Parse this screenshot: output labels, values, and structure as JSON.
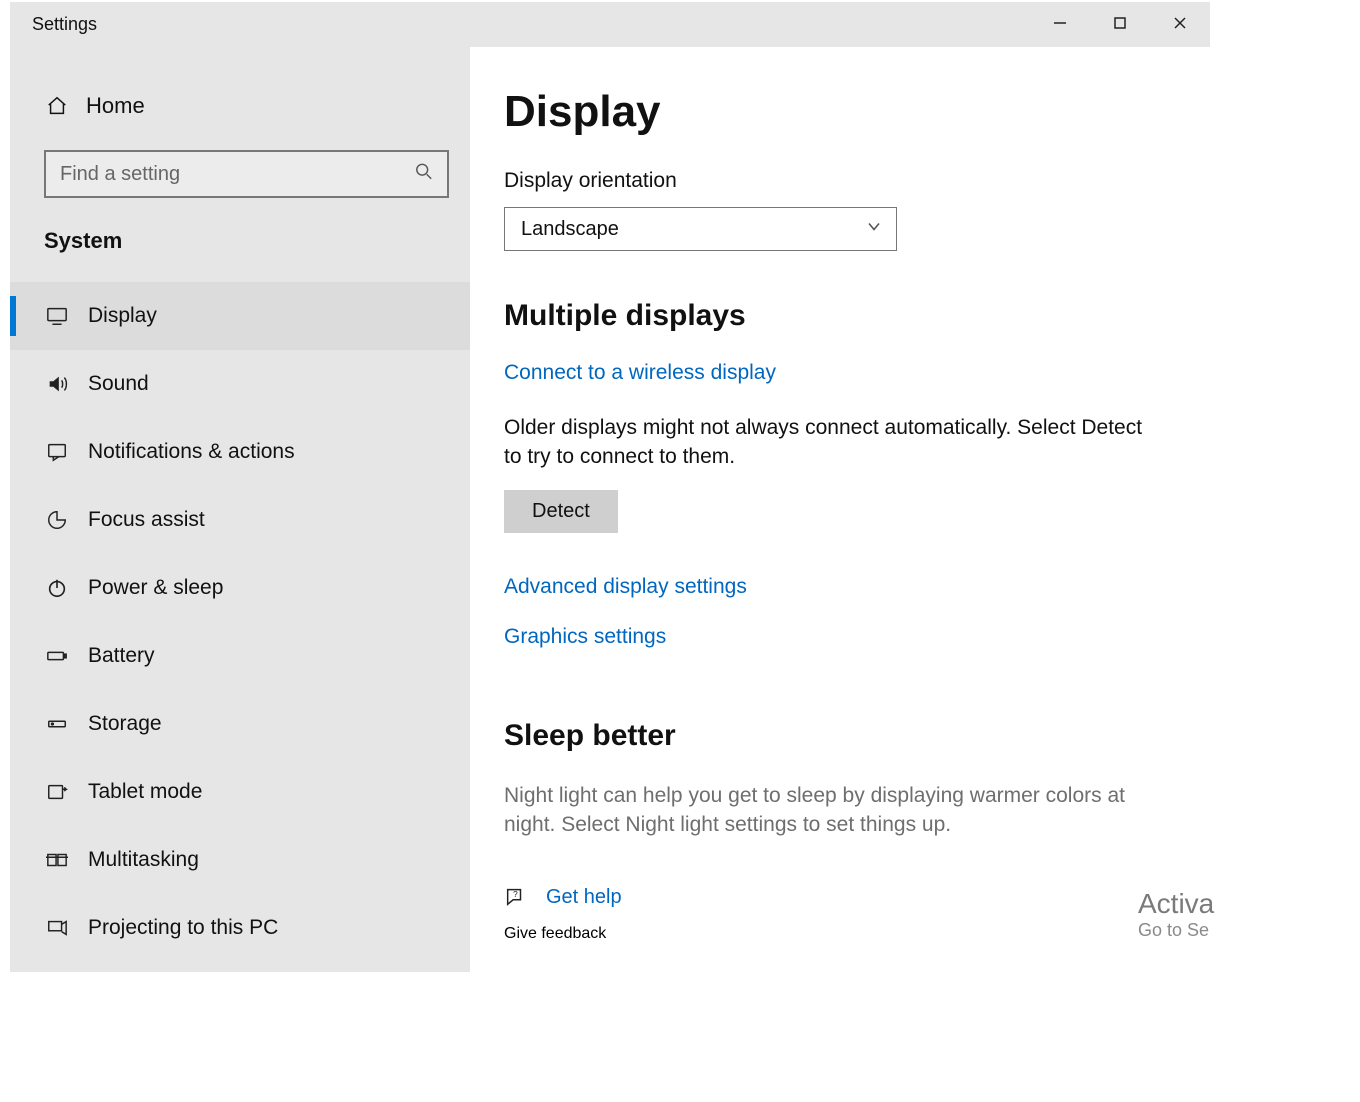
{
  "window": {
    "title": "Settings"
  },
  "sidebar": {
    "home": "Home",
    "search_placeholder": "Find a setting",
    "category": "System",
    "items": [
      {
        "label": "Display"
      },
      {
        "label": "Sound"
      },
      {
        "label": "Notifications & actions"
      },
      {
        "label": "Focus assist"
      },
      {
        "label": "Power & sleep"
      },
      {
        "label": "Battery"
      },
      {
        "label": "Storage"
      },
      {
        "label": "Tablet mode"
      },
      {
        "label": "Multitasking"
      },
      {
        "label": "Projecting to this PC"
      }
    ]
  },
  "main": {
    "title": "Display",
    "orientation_label": "Display orientation",
    "orientation_value": "Landscape",
    "multi_header": "Multiple displays",
    "connect_link": "Connect to a wireless display",
    "older_text": "Older displays might not always connect automatically. Select Detect to try to connect to them.",
    "detect_btn": "Detect",
    "adv_link": "Advanced display settings",
    "gfx_link": "Graphics settings",
    "sleep_header": "Sleep better",
    "sleep_desc": "Night light can help you get to sleep by displaying warmer colors at night. Select Night light settings to set things up.",
    "get_help": "Get help",
    "give_feedback": "Give feedback"
  },
  "watermark": {
    "line1": "Activa",
    "line2": "Go to Se"
  }
}
